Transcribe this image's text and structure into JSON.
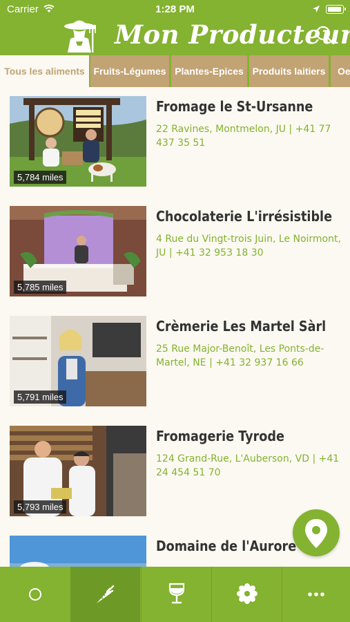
{
  "status_bar": {
    "carrier": "Carrier",
    "time": "1:28 PM"
  },
  "header": {
    "title": "Mon Producteur",
    "logo_icon": "farmer-logo-icon",
    "search_icon": "search-icon"
  },
  "categories": [
    {
      "label": "Tous les aliments",
      "active": true
    },
    {
      "label": "Fruits-Légumes",
      "active": false
    },
    {
      "label": "Plantes-Epices",
      "active": false
    },
    {
      "label": "Produits laitiers",
      "active": false
    },
    {
      "label": "Oe",
      "active": false
    }
  ],
  "producers": [
    {
      "name": "Fromage le St-Ursanne",
      "address": "22 Ravines, Montmelon, JU | +41 77 437 35 51",
      "distance": "5,784 miles"
    },
    {
      "name": "Chocolaterie L'irrésistible",
      "address": "4 Rue du Vingt-trois Juin, Le Noirmont, JU | +41 32 953 18 30",
      "distance": "5,785 miles"
    },
    {
      "name": "Crèmerie Les Martel Sàrl",
      "address": "25 Rue Major-Benoît, Les Ponts-de-Martel, NE | +41 32 937 16 66",
      "distance": "5,791 miles"
    },
    {
      "name": "Fromagerie Tyrode",
      "address": "124 Grand-Rue, L'Auberson, VD | +41 24 454 51 70",
      "distance": "5,793 miles"
    },
    {
      "name": "Domaine de l'Aurore",
      "address": "",
      "distance": ""
    }
  ],
  "map_button": {
    "icon": "map-pin-icon"
  },
  "tab_bar": [
    {
      "icon": "circle-icon",
      "selected": false
    },
    {
      "icon": "carrot-icon",
      "selected": true
    },
    {
      "icon": "wine-glass-icon",
      "selected": false
    },
    {
      "icon": "flower-icon",
      "selected": false
    },
    {
      "icon": "more-dots-icon",
      "selected": false
    }
  ],
  "colors": {
    "brand_green": "#84b231",
    "tab_tan": "#c2a374",
    "background": "#fbf9f1"
  }
}
